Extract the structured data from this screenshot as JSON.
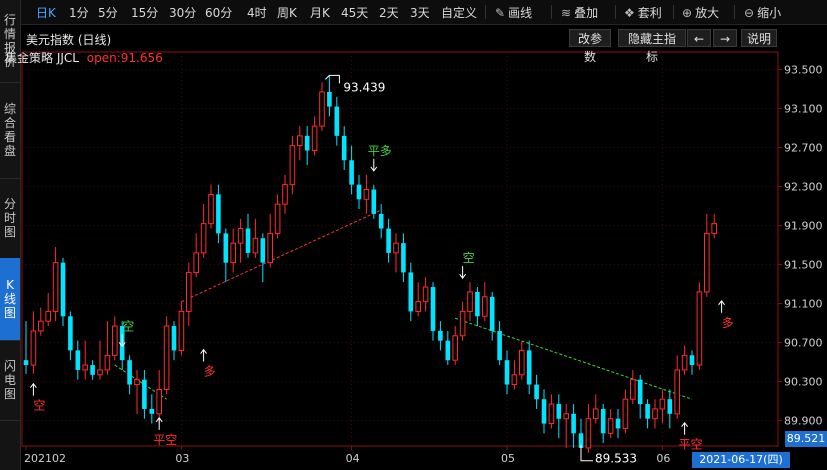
{
  "sidebar": [
    {
      "label": "行情报价",
      "active": false
    },
    {
      "label": "综合看盘",
      "active": false
    },
    {
      "label": "分时图",
      "active": false
    },
    {
      "label": "K线图",
      "active": true
    },
    {
      "label": "闪电图",
      "active": false
    }
  ],
  "toolbar": {
    "periods": [
      "日K",
      "1分",
      "5分",
      "15分",
      "30分",
      "60分",
      "4时",
      "周K",
      "月K",
      "45天",
      "2天",
      "3天",
      "自定义"
    ],
    "active_period": "日K",
    "tools": [
      {
        "label": "画线",
        "icon": "pencil-icon",
        "glyph": "✎"
      },
      {
        "label": "叠加",
        "icon": "stack-icon",
        "glyph": "≋"
      },
      {
        "label": "套利",
        "icon": "money-bag-icon",
        "glyph": "❖"
      },
      {
        "label": "放大",
        "icon": "zoom-in-icon",
        "glyph": "⊕"
      },
      {
        "label": "缩小",
        "icon": "zoom-out-icon",
        "glyph": "⊖"
      }
    ]
  },
  "header": {
    "title": "美元指数 (日线)",
    "buttons": [
      {
        "label": "改参数"
      },
      {
        "label": "隐藏主指标"
      },
      {
        "label": "←"
      },
      {
        "label": "→"
      },
      {
        "label": "说明"
      }
    ]
  },
  "strategy": {
    "name": "集金策略 JJCL",
    "open_label": "open:91.656"
  },
  "chart_data": {
    "type": "candlestick",
    "y_ticks": [
      93.5,
      93.1,
      92.7,
      92.3,
      91.9,
      91.5,
      91.1,
      90.7,
      90.3,
      89.9
    ],
    "y_tick_labels": [
      "93.500",
      "93.100",
      "92.700",
      "92.300",
      "91.900",
      "91.500",
      "91.100",
      "90.700",
      "90.300",
      "89.900"
    ],
    "ylim": [
      89.64,
      93.68
    ],
    "x_labels": [
      {
        "label": "202102",
        "index": 0
      },
      {
        "label": "03",
        "index": 21
      },
      {
        "label": "04",
        "index": 44
      },
      {
        "label": "05",
        "index": 65
      },
      {
        "label": "06",
        "index": 86
      }
    ],
    "candles": [
      [
        90.52,
        90.47,
        90.92,
        90.38
      ],
      [
        90.47,
        90.82,
        91.02,
        90.38
      ],
      [
        90.82,
        90.92,
        91.06,
        90.77
      ],
      [
        90.92,
        91.02,
        91.21,
        90.87
      ],
      [
        91.02,
        91.52,
        91.68,
        90.92
      ],
      [
        91.52,
        90.97,
        91.57,
        90.87
      ],
      [
        90.97,
        90.62,
        91.02,
        90.52
      ],
      [
        90.62,
        90.42,
        90.72,
        90.32
      ],
      [
        90.42,
        90.47,
        90.72,
        90.32
      ],
      [
        90.47,
        90.37,
        90.52,
        90.32
      ],
      [
        90.37,
        90.42,
        90.72,
        90.32
      ],
      [
        90.42,
        90.57,
        90.92,
        90.37
      ],
      [
        90.57,
        90.87,
        90.97,
        90.52
      ],
      [
        90.87,
        90.52,
        90.92,
        90.42
      ],
      [
        90.52,
        90.27,
        90.57,
        90.17
      ],
      [
        90.27,
        90.32,
        90.42,
        89.97
      ],
      [
        90.32,
        90.02,
        90.42,
        89.92
      ],
      [
        90.02,
        89.97,
        90.17,
        89.87
      ],
      [
        89.97,
        90.22,
        90.42,
        89.87
      ],
      [
        90.22,
        90.87,
        90.97,
        90.17
      ],
      [
        90.87,
        90.62,
        90.92,
        90.52
      ],
      [
        90.62,
        91.02,
        91.12,
        90.57
      ],
      [
        91.02,
        91.42,
        91.52,
        90.87
      ],
      [
        91.42,
        91.62,
        91.82,
        91.37
      ],
      [
        91.62,
        91.92,
        92.12,
        91.57
      ],
      [
        91.92,
        92.22,
        92.32,
        91.87
      ],
      [
        92.22,
        91.82,
        92.32,
        91.72
      ],
      [
        91.82,
        91.52,
        91.87,
        91.32
      ],
      [
        91.52,
        91.72,
        91.87,
        91.42
      ],
      [
        91.72,
        91.87,
        91.97,
        91.52
      ],
      [
        91.87,
        91.62,
        92.02,
        91.57
      ],
      [
        91.62,
        91.77,
        91.97,
        91.57
      ],
      [
        91.77,
        91.52,
        91.82,
        91.32
      ],
      [
        91.52,
        91.82,
        92.02,
        91.47
      ],
      [
        91.82,
        92.12,
        92.22,
        91.77
      ],
      [
        92.12,
        92.32,
        92.42,
        92.02
      ],
      [
        92.32,
        92.72,
        92.82,
        92.22
      ],
      [
        92.72,
        92.82,
        92.92,
        92.57
      ],
      [
        92.82,
        92.67,
        92.92,
        92.52
      ],
      [
        92.67,
        92.92,
        93.02,
        92.62
      ],
      [
        92.92,
        93.27,
        93.37,
        92.87
      ],
      [
        93.27,
        93.12,
        93.44,
        93.02
      ],
      [
        93.12,
        92.82,
        93.22,
        92.72
      ],
      [
        92.82,
        92.57,
        92.92,
        92.47
      ],
      [
        92.57,
        92.32,
        92.72,
        92.22
      ],
      [
        92.32,
        92.17,
        92.42,
        92.07
      ],
      [
        92.17,
        92.27,
        92.42,
        92.02
      ],
      [
        92.27,
        92.02,
        92.32,
        91.97
      ],
      [
        92.02,
        91.87,
        92.12,
        91.77
      ],
      [
        91.87,
        91.62,
        91.97,
        91.52
      ],
      [
        91.62,
        91.72,
        91.82,
        91.42
      ],
      [
        91.72,
        91.42,
        91.82,
        91.32
      ],
      [
        91.42,
        91.02,
        91.52,
        90.92
      ],
      [
        91.02,
        91.12,
        91.32,
        90.97
      ],
      [
        91.12,
        91.27,
        91.37,
        91.02
      ],
      [
        91.27,
        90.82,
        91.32,
        90.72
      ],
      [
        90.82,
        90.72,
        90.92,
        90.62
      ],
      [
        90.72,
        90.52,
        90.82,
        90.47
      ],
      [
        90.52,
        90.77,
        90.87,
        90.47
      ],
      [
        90.77,
        91.02,
        91.12,
        90.72
      ],
      [
        91.02,
        91.22,
        91.32,
        90.92
      ],
      [
        91.22,
        90.97,
        91.27,
        90.87
      ],
      [
        90.97,
        91.17,
        91.32,
        90.92
      ],
      [
        91.17,
        90.82,
        91.22,
        90.72
      ],
      [
        90.82,
        90.52,
        90.92,
        90.47
      ],
      [
        90.52,
        90.27,
        90.62,
        90.17
      ],
      [
        90.27,
        90.37,
        90.52,
        90.22
      ],
      [
        90.37,
        90.62,
        90.72,
        90.32
      ],
      [
        90.62,
        90.27,
        90.72,
        90.17
      ],
      [
        90.27,
        90.12,
        90.37,
        90.02
      ],
      [
        90.12,
        89.87,
        90.22,
        89.77
      ],
      [
        89.87,
        90.07,
        90.17,
        89.82
      ],
      [
        90.07,
        89.92,
        90.17,
        89.72
      ],
      [
        89.92,
        89.97,
        90.07,
        89.62
      ],
      [
        89.97,
        89.77,
        90.07,
        89.62
      ],
      [
        89.77,
        89.62,
        89.92,
        89.53
      ],
      [
        89.62,
        89.92,
        90.07,
        89.57
      ],
      [
        89.92,
        90.02,
        90.17,
        89.87
      ],
      [
        90.02,
        89.77,
        90.07,
        89.67
      ],
      [
        89.77,
        89.92,
        90.02,
        89.72
      ],
      [
        89.92,
        89.82,
        90.02,
        89.72
      ],
      [
        89.82,
        90.12,
        90.22,
        89.77
      ],
      [
        90.12,
        90.32,
        90.42,
        90.07
      ],
      [
        90.32,
        90.07,
        90.37,
        89.92
      ],
      [
        90.07,
        89.92,
        90.12,
        89.82
      ],
      [
        89.92,
        90.02,
        90.12,
        89.82
      ],
      [
        90.02,
        90.12,
        90.22,
        89.87
      ],
      [
        90.12,
        89.97,
        90.22,
        89.82
      ],
      [
        89.97,
        90.42,
        90.57,
        89.92
      ],
      [
        90.42,
        90.57,
        90.67,
        90.37
      ],
      [
        90.57,
        90.47,
        90.62,
        90.37
      ],
      [
        90.47,
        91.22,
        91.32,
        90.42
      ],
      [
        91.22,
        91.82,
        92.02,
        91.17
      ],
      [
        91.82,
        91.92,
        92.02,
        91.77
      ]
    ],
    "trend_lines": [
      {
        "from": [
          12,
          90.47
        ],
        "to": [
          19,
          90.12
        ],
        "color": "#3dd63d",
        "dash": true
      },
      {
        "from": [
          21,
          91.12
        ],
        "to": [
          48,
          92.06
        ],
        "color": "#ff3030",
        "dash": true
      },
      {
        "from": [
          58,
          90.95
        ],
        "to": [
          90,
          90.12
        ],
        "color": "#3dd63d",
        "dash": true
      }
    ],
    "annotations": [
      {
        "index": 1,
        "price": 90.32,
        "dir": "up",
        "text": "空",
        "color": "#ff3030"
      },
      {
        "index": 13,
        "price": 90.62,
        "dir": "down",
        "text": "空",
        "color": "#3dd63d"
      },
      {
        "index": 18,
        "price": 89.97,
        "dir": "up",
        "text": "平空",
        "color": "#ff3030"
      },
      {
        "index": 24,
        "price": 90.67,
        "dir": "up",
        "text": "多",
        "color": "#ff3030"
      },
      {
        "index": 47,
        "price": 92.42,
        "dir": "down",
        "text": "平多",
        "color": "#3dd63d"
      },
      {
        "index": 59,
        "price": 91.32,
        "dir": "down",
        "text": "空",
        "color": "#3dd63d"
      },
      {
        "index": 89,
        "price": 89.92,
        "dir": "up",
        "text": "平空",
        "color": "#ff3030"
      },
      {
        "index": 94,
        "price": 91.17,
        "dir": "up",
        "text": "多",
        "color": "#ff3030"
      }
    ],
    "high_label": {
      "index": 41,
      "price": 93.44,
      "text": "93.439"
    },
    "low_label": {
      "index": 75,
      "price": 89.53,
      "text": "89.533"
    }
  },
  "status": {
    "date": "2021-06-17(四)",
    "price": "89.521"
  }
}
